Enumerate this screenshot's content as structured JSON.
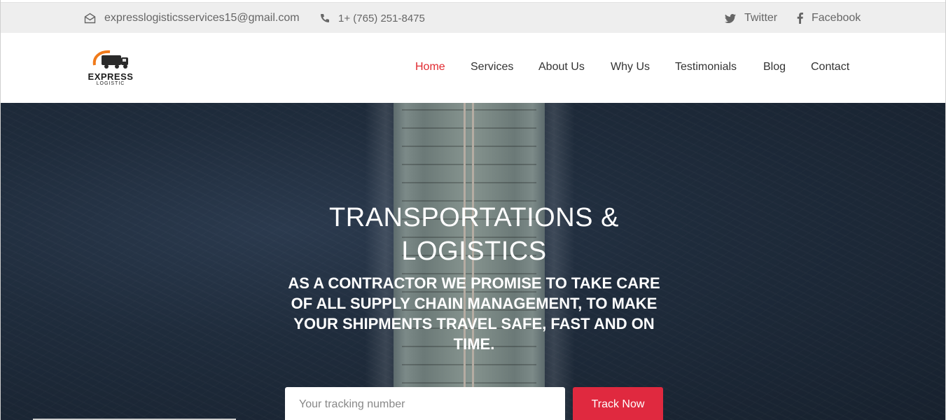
{
  "topbar": {
    "email": "expresslogisticsservices15@gmail.com",
    "phone": "1+ (765) 251-8475",
    "social": [
      {
        "label": "Twitter",
        "icon": "twitter-icon"
      },
      {
        "label": "Facebook",
        "icon": "facebook-icon"
      }
    ]
  },
  "logo": {
    "title": "EXPRESS",
    "subtitle": "LOGISTIC"
  },
  "nav": {
    "items": [
      {
        "label": "Home",
        "active": true
      },
      {
        "label": "Services"
      },
      {
        "label": "About Us"
      },
      {
        "label": "Why Us"
      },
      {
        "label": "Testimonials"
      },
      {
        "label": "Blog"
      },
      {
        "label": "Contact"
      }
    ]
  },
  "hero": {
    "title": "TRANSPORTATIONS & LOGISTICS",
    "subtitle": "AS A CONTRACTOR WE PROMISE TO TAKE CARE OF ALL SUPPLY CHAIN MANAGEMENT, TO MAKE YOUR SHIPMENTS TRAVEL SAFE, FAST AND ON TIME.",
    "tracking_placeholder": "Your tracking number",
    "track_button": "Track Now"
  },
  "colors": {
    "accent": "#e0292f",
    "button": "#e0293f",
    "topbar_bg": "#eeeeee"
  }
}
